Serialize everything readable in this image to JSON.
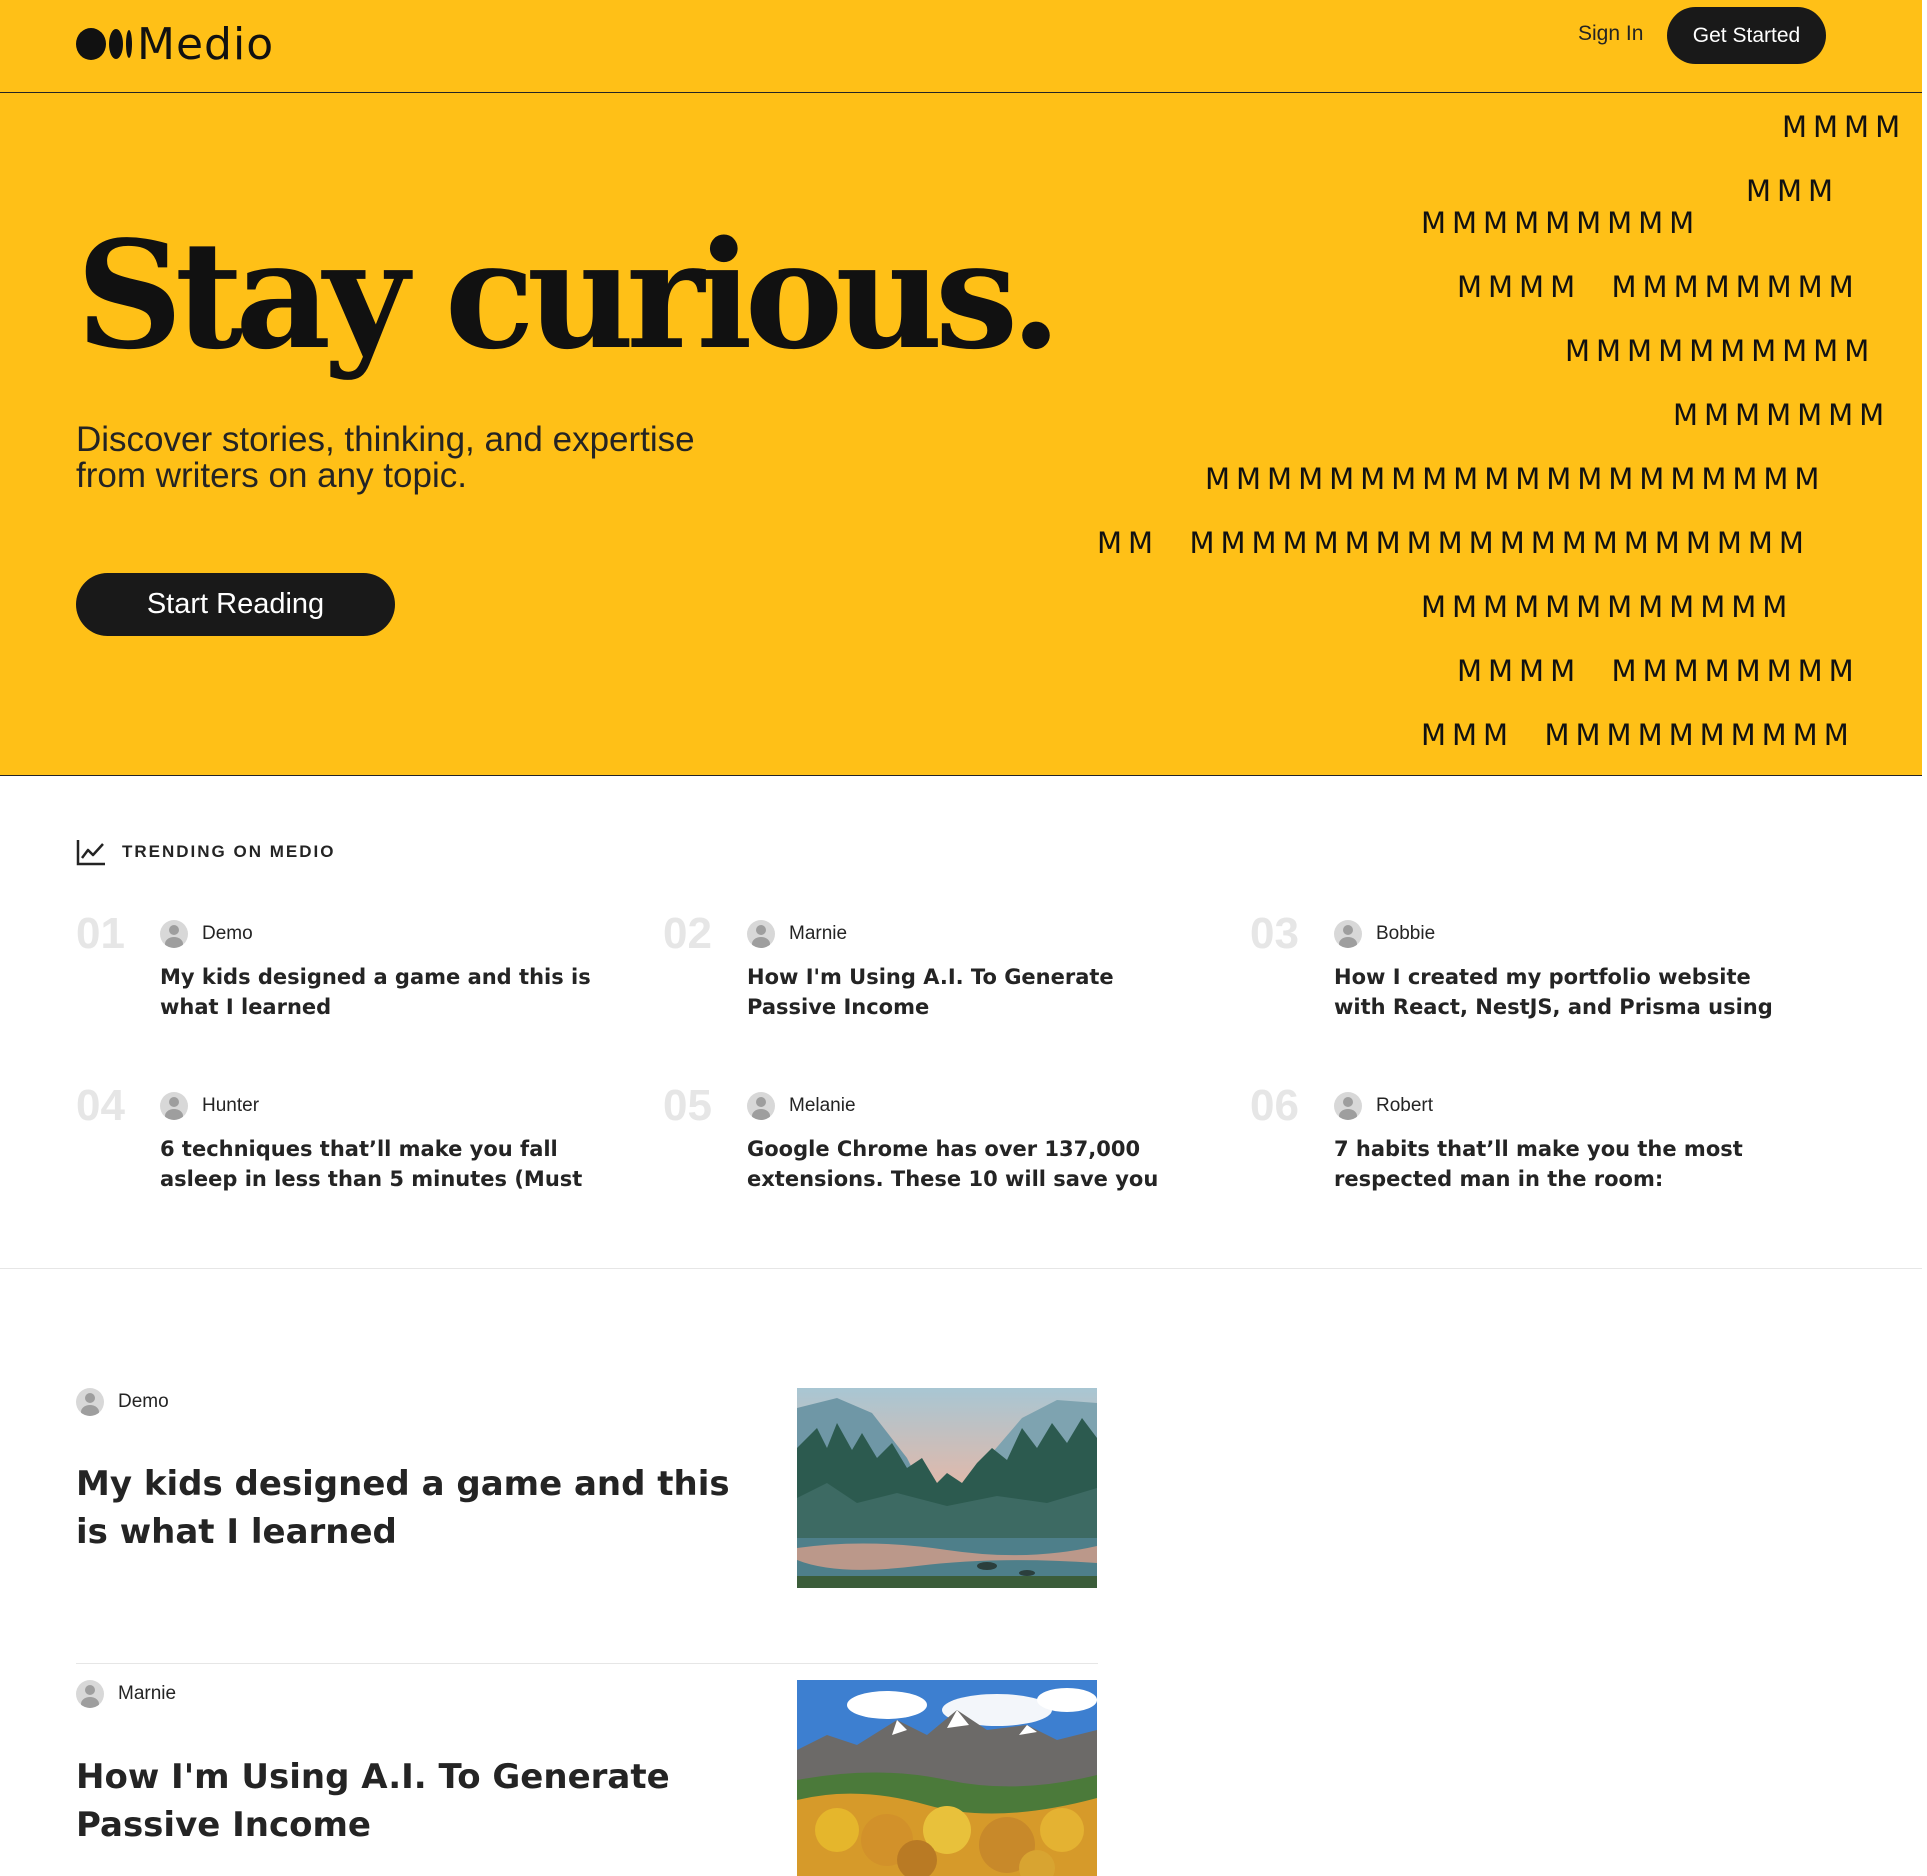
{
  "brand": {
    "name": "Medio",
    "accent": "#FFC017"
  },
  "header": {
    "signin_label": "Sign In",
    "cta_label": "Get Started"
  },
  "hero": {
    "title": "Stay curious.",
    "subtitle_line1": "Discover stories, thinking, and expertise",
    "subtitle_line2": "from writers on any topic.",
    "cta_label": "Start Reading",
    "m_rows": [
      "MMMM",
      "MMM",
      "MMMMMMMMM",
      "MMMM  MMMMMMMM",
      "MMMMMMMMMM",
      "MMMMMMM",
      "MMMMMMMMMMMMMMMMMMMM",
      "MM  MMMMMMMMMMMMMMMMMMMM",
      "MMMMMMMMMMMM",
      "MMMM  MMMMMMMM",
      "MMM  MMMMMMMMMM"
    ]
  },
  "trending": {
    "label": "TRENDING ON MEDIO",
    "icon": "trending-chart-icon",
    "items": [
      {
        "num": "01",
        "author": "Demo",
        "title": "My kids designed a game and this is what I learned"
      },
      {
        "num": "02",
        "author": "Marnie",
        "title": "How I'm Using A.I. To Generate Passive Income"
      },
      {
        "num": "03",
        "author": "Bobbie",
        "title": "How I created my portfolio website with React, NestJS, and Prisma using"
      },
      {
        "num": "04",
        "author": "Hunter",
        "title": "6 techniques that’ll make you fall asleep in less than 5 minutes (Must"
      },
      {
        "num": "05",
        "author": "Melanie",
        "title": "Google Chrome has over 137,000 extensions. These 10 will save you"
      },
      {
        "num": "06",
        "author": "Robert",
        "title": "7 habits that’ll make you the most respected man in the room:"
      }
    ]
  },
  "feed": {
    "articles": [
      {
        "author": "Demo",
        "title": "My kids designed a game and this is what I learned",
        "image": "valley-river-landscape"
      },
      {
        "author": "Marnie",
        "title": "How I'm Using A.I. To Generate Passive Income",
        "image": "autumn-mountain-landscape"
      }
    ]
  }
}
